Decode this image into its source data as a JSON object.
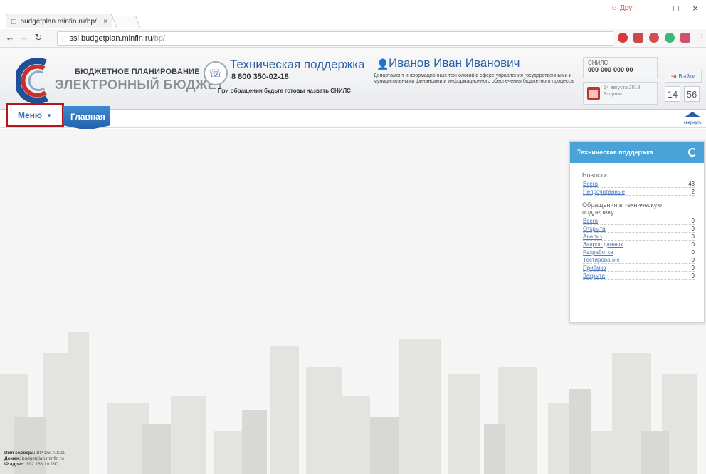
{
  "browser": {
    "tab_title": "budgetplan.minfin.ru/bp/",
    "tab_close": "×",
    "user_badge": "Друг",
    "url_host": "ssl.budgetplan.minfin.ru",
    "url_path": "/bp/",
    "minimize": "–",
    "maximize": "□",
    "close": "×"
  },
  "header": {
    "logo_top": "БЮДЖЕТНОЕ ПЛАНИРОВАНИЕ",
    "logo_bottom": "ЭЛЕКТРОННЫЙ БЮДЖЕТ",
    "support_title": "Техническая поддержка",
    "support_phone": "8 800 350-02-18",
    "support_note": "При обращении будьте готовы назвать СНИЛС",
    "user_name": "Иванов Иван Иванович",
    "user_dept": "Департамент информационных технологий в сфере управления государственными и муниципальными финансами и информационного обеспечения бюджетного процесса",
    "snils_label": "СНИЛС",
    "snils_value": "000-000-000 00",
    "date": "14 августа 2018",
    "weekday": "Вторник",
    "logout": "Выйти",
    "clock_h": "14",
    "clock_m": "56"
  },
  "nav": {
    "menu_label": "Меню",
    "home_label": "Главная",
    "collapse_label": "свернуть"
  },
  "widget": {
    "title": "Техническая поддержка",
    "news_title": "Новости",
    "news": [
      {
        "label": "Всего",
        "count": "43"
      },
      {
        "label": "Непрочитанные",
        "count": "2"
      }
    ],
    "requests_title": "Обращения в техническую поддержку",
    "requests": [
      {
        "label": "Всего",
        "count": "0"
      },
      {
        "label": "Открыта",
        "count": "0"
      },
      {
        "label": "Анализ",
        "count": "0"
      },
      {
        "label": "Запрос данных",
        "count": "0"
      },
      {
        "label": "Разработка",
        "count": "0"
      },
      {
        "label": "Тестирование",
        "count": "0"
      },
      {
        "label": "Приёмка",
        "count": "0"
      },
      {
        "label": "Закрыта",
        "count": "0"
      }
    ]
  },
  "server": {
    "name_label": "Имя сервера:",
    "name_value": "BP-DS-A0010",
    "domain_label": "Домен:",
    "domain_value": "budgetplan.minfin.ru",
    "ip_label": "IP адрес:",
    "ip_value": "192.168.10.190"
  },
  "colors": {
    "brand_blue": "#2a5da8",
    "tab_blue": "#1f5fa8",
    "widget_head": "#4aa3d8",
    "highlight_red": "#b8151b"
  }
}
